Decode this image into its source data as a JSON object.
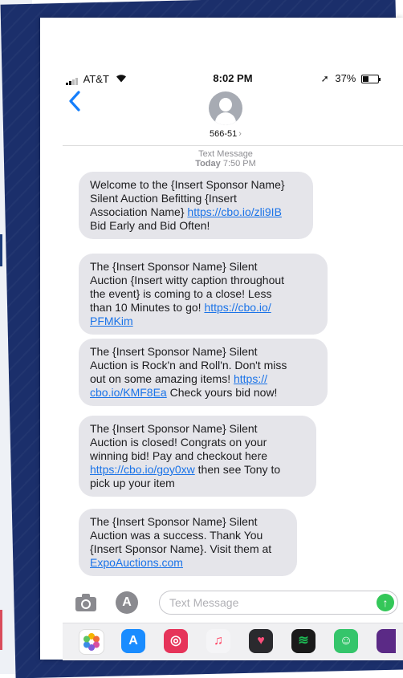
{
  "status_bar": {
    "carrier": "AT&T",
    "time": "8:02 PM",
    "battery": "37%",
    "battery_level": 0.37
  },
  "header": {
    "contact": "566-51",
    "chevron": "›"
  },
  "thread": {
    "type": "Text Message",
    "day": "Today",
    "time": "7:50 PM"
  },
  "messages": [
    {
      "line1": "Welcome to the {Insert Sponsor Name}",
      "line2": "Silent Auction Befitting {Insert",
      "line3_text": "Association Name} ",
      "link": "https://cbo.io/zli9IB",
      "line4": "Bid Early and Bid Often!"
    },
    {
      "line1": "The {Insert Sponsor Name} Silent",
      "line2": "Auction {Insert witty caption throughout",
      "line3": "the event} is coming to a close! Less",
      "line4_text": "than 10 Minutes to go! ",
      "link_part1": "https://cbo.io/",
      "link_part2": "PFMKim"
    },
    {
      "line1": "The {Insert Sponsor Name} Silent",
      "line2": "Auction is Rock'n and Roll'n. Don't miss",
      "line3_text": "out on some amazing items! ",
      "link_part1": "https://",
      "link_part2": "cbo.io/KMF8Ea",
      "line4_text": " Check yours bid now!"
    },
    {
      "line1": "The {Insert Sponsor Name} Silent",
      "line2": "Auction is closed! Congrats on your",
      "line3": "winning bid! Pay and checkout here",
      "link": "https://cbo.io/goy0xw",
      "line4_text": " then see Tony to",
      "line5": "pick up your item"
    },
    {
      "line1": "The {Insert Sponsor Name} Silent",
      "line2": "Auction was a success. Thank You",
      "line3": "{Insert Sponsor Name}. Visit them at",
      "link": "ExpoAuctions.com"
    }
  ],
  "input": {
    "placeholder": "Text Message"
  },
  "app_drawer": [
    {
      "name": "photos-app-icon",
      "color": "#ffffff"
    },
    {
      "name": "app-store-icon",
      "color": "#1a8cff"
    },
    {
      "name": "web-search-app-icon",
      "color": "#e6345a"
    },
    {
      "name": "music-app-icon",
      "color": "#ff3b5c"
    },
    {
      "name": "heart-app-icon",
      "color": "#ff4f7b"
    },
    {
      "name": "spotify-icon",
      "color": "#1db954"
    },
    {
      "name": "bitmoji-icon",
      "color": "#35c56b"
    },
    {
      "name": "purple-app-icon",
      "color": "#5b2a86"
    }
  ],
  "colors": {
    "poster": "#1b2f6b",
    "bubble": "#e5e5ea",
    "link": "#1a73e8",
    "ios_blue": "#147efb",
    "send": "#34c759"
  }
}
